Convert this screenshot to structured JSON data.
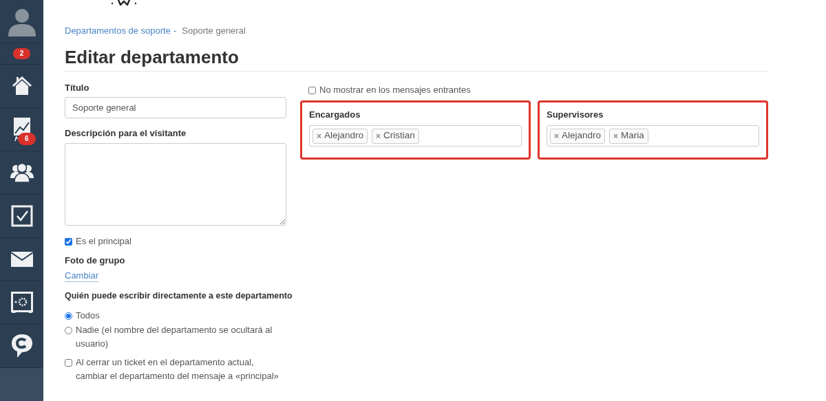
{
  "sidebar": {
    "items": [
      {
        "kind": "avatar"
      },
      {
        "kind": "badge",
        "badge": "2"
      },
      {
        "kind": "home"
      },
      {
        "kind": "chart",
        "badge": "6"
      },
      {
        "kind": "people"
      },
      {
        "kind": "tasks"
      },
      {
        "kind": "mail"
      },
      {
        "kind": "safe"
      },
      {
        "kind": "chat"
      }
    ]
  },
  "breadcrumb": {
    "link": "Departamentos de soporte",
    "separator": "-",
    "current": "Soporte general"
  },
  "title": "Editar departamento",
  "form": {
    "title_label": "Título",
    "title_value": "Soporte general",
    "description_label": "Descripción para el visitante",
    "main_checkbox": {
      "label": "Es el principal",
      "checked": true
    },
    "photo_label": "Foto de grupo",
    "photo_link": "Cambiar",
    "who_label": "Quién puede escribir directamente a este departamento",
    "who_options": [
      {
        "label": "Todos",
        "selected": true
      },
      {
        "label": "Nadie (el nombre del departamento se ocultará al usuario)",
        "selected": false
      }
    ],
    "close_checkbox": {
      "label": "Al cerrar un ticket en el departamento actual, cambiar el departamento del mensaje a «principal»",
      "checked": false
    },
    "hide_checkbox": {
      "label": "No mostrar en los mensajes entrantes",
      "checked": false
    },
    "groups": [
      {
        "label": "Encargados",
        "highlighted": true,
        "tags": [
          {
            "remove": "×",
            "name": "Alejandro"
          },
          {
            "remove": "×",
            "name": "Cristian"
          }
        ]
      },
      {
        "label": "Supervisores",
        "highlighted": true,
        "tags": [
          {
            "remove": "×",
            "name": "Alejandro"
          },
          {
            "remove": "×",
            "name": "Maria"
          }
        ]
      }
    ]
  }
}
